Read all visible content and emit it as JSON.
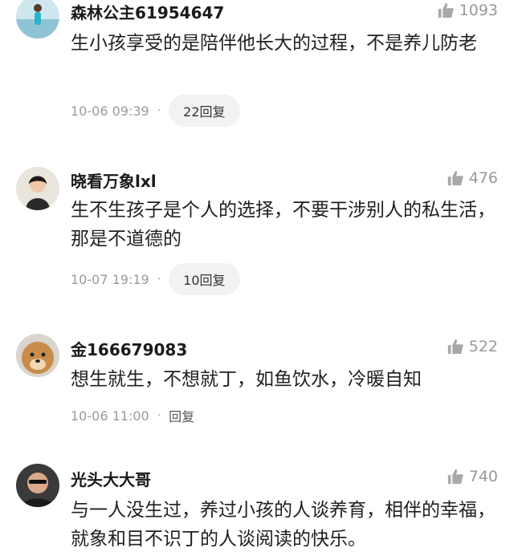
{
  "comments": [
    {
      "username": "森林公主61954647",
      "likes": "1093",
      "text": "生小孩享受的是陪伴他长大的过程，不是养儿防老",
      "time": "10-06 09:39",
      "separator": "·",
      "reply": "22回复"
    },
    {
      "username": "晓看万象lxl",
      "likes": "476",
      "text": "生不生孩子是个人的选择，不要干涉别人的私生活，那是不道德的",
      "time": "10-07 19:19",
      "separator": "·",
      "reply": "10回复"
    },
    {
      "username": "金166679083",
      "likes": "522",
      "text": "想生就生，不想就丁，如鱼饮水，冷暖自知",
      "time": "10-06 11:00",
      "separator": "·",
      "reply": "回复"
    },
    {
      "username": "光头大大哥",
      "likes": "740",
      "text": "与一人没生过，养过小孩的人谈养育，相伴的幸福，就象和目不识丁的人谈阅读的快乐。",
      "time": "",
      "separator": "",
      "reply": ""
    }
  ],
  "icons": {
    "like": "thumbs-up-icon"
  },
  "colors": {
    "muted": "#9a9a9a",
    "pill": "#f2f2f2"
  }
}
